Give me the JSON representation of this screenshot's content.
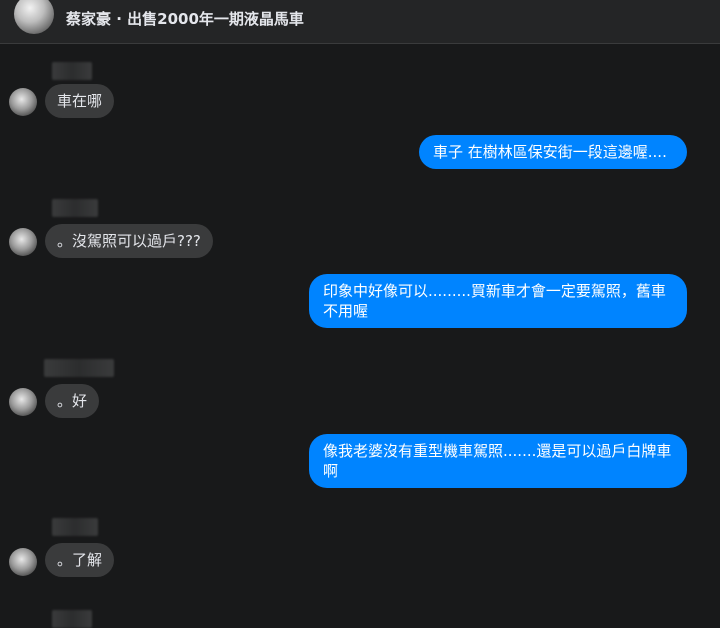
{
  "header": {
    "title": "蔡家豪 · 出售2000年一期液晶馬車"
  },
  "messages": [
    {
      "direction": "incoming",
      "text": "車在哪"
    },
    {
      "direction": "outgoing",
      "text": "車子 在樹林區保安街一段這邊喔...."
    },
    {
      "direction": "incoming",
      "text": "。沒駕照可以過戶???"
    },
    {
      "direction": "outgoing",
      "text": "印象中好像可以.........買新車才會一定要駕照，舊車不用喔"
    },
    {
      "direction": "incoming",
      "text": "。好"
    },
    {
      "direction": "outgoing",
      "text": "像我老婆沒有重型機車駕照.......還是可以過戶白牌車啊"
    },
    {
      "direction": "incoming",
      "text": "。了解"
    }
  ],
  "colors": {
    "background": "#18191a",
    "incoming_bubble": "#3a3b3c",
    "outgoing_bubble": "#0084ff"
  }
}
